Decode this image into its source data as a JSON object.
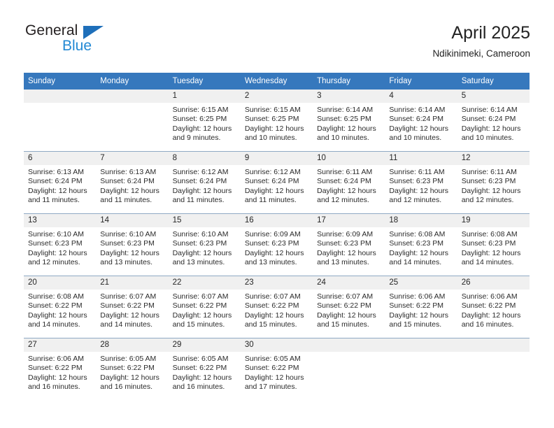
{
  "brand": {
    "name_part1": "General",
    "name_part2": "Blue",
    "triangle_color": "#1e6fba",
    "blue_color": "#2389d4"
  },
  "header": {
    "title": "April 2025",
    "subtitle": "Ndikinimeki, Cameroon"
  },
  "theme": {
    "header_row_bg": "#3678bd",
    "day_number_bg": "#f0f0f0",
    "grid_line": "#8fa9c4",
    "text": "#2b2b2b"
  },
  "weekday_headers": [
    "Sunday",
    "Monday",
    "Tuesday",
    "Wednesday",
    "Thursday",
    "Friday",
    "Saturday"
  ],
  "weeks": [
    [
      {
        "day": "",
        "empty": true,
        "sunrise": "",
        "sunset": "",
        "daylight_line1": "",
        "daylight_line2": ""
      },
      {
        "day": "",
        "empty": true,
        "sunrise": "",
        "sunset": "",
        "daylight_line1": "",
        "daylight_line2": ""
      },
      {
        "day": "1",
        "sunrise": "Sunrise: 6:15 AM",
        "sunset": "Sunset: 6:25 PM",
        "daylight_line1": "Daylight: 12 hours",
        "daylight_line2": "and 9 minutes."
      },
      {
        "day": "2",
        "sunrise": "Sunrise: 6:15 AM",
        "sunset": "Sunset: 6:25 PM",
        "daylight_line1": "Daylight: 12 hours",
        "daylight_line2": "and 10 minutes."
      },
      {
        "day": "3",
        "sunrise": "Sunrise: 6:14 AM",
        "sunset": "Sunset: 6:25 PM",
        "daylight_line1": "Daylight: 12 hours",
        "daylight_line2": "and 10 minutes."
      },
      {
        "day": "4",
        "sunrise": "Sunrise: 6:14 AM",
        "sunset": "Sunset: 6:24 PM",
        "daylight_line1": "Daylight: 12 hours",
        "daylight_line2": "and 10 minutes."
      },
      {
        "day": "5",
        "sunrise": "Sunrise: 6:14 AM",
        "sunset": "Sunset: 6:24 PM",
        "daylight_line1": "Daylight: 12 hours",
        "daylight_line2": "and 10 minutes."
      }
    ],
    [
      {
        "day": "6",
        "sunrise": "Sunrise: 6:13 AM",
        "sunset": "Sunset: 6:24 PM",
        "daylight_line1": "Daylight: 12 hours",
        "daylight_line2": "and 11 minutes."
      },
      {
        "day": "7",
        "sunrise": "Sunrise: 6:13 AM",
        "sunset": "Sunset: 6:24 PM",
        "daylight_line1": "Daylight: 12 hours",
        "daylight_line2": "and 11 minutes."
      },
      {
        "day": "8",
        "sunrise": "Sunrise: 6:12 AM",
        "sunset": "Sunset: 6:24 PM",
        "daylight_line1": "Daylight: 12 hours",
        "daylight_line2": "and 11 minutes."
      },
      {
        "day": "9",
        "sunrise": "Sunrise: 6:12 AM",
        "sunset": "Sunset: 6:24 PM",
        "daylight_line1": "Daylight: 12 hours",
        "daylight_line2": "and 11 minutes."
      },
      {
        "day": "10",
        "sunrise": "Sunrise: 6:11 AM",
        "sunset": "Sunset: 6:24 PM",
        "daylight_line1": "Daylight: 12 hours",
        "daylight_line2": "and 12 minutes."
      },
      {
        "day": "11",
        "sunrise": "Sunrise: 6:11 AM",
        "sunset": "Sunset: 6:23 PM",
        "daylight_line1": "Daylight: 12 hours",
        "daylight_line2": "and 12 minutes."
      },
      {
        "day": "12",
        "sunrise": "Sunrise: 6:11 AM",
        "sunset": "Sunset: 6:23 PM",
        "daylight_line1": "Daylight: 12 hours",
        "daylight_line2": "and 12 minutes."
      }
    ],
    [
      {
        "day": "13",
        "sunrise": "Sunrise: 6:10 AM",
        "sunset": "Sunset: 6:23 PM",
        "daylight_line1": "Daylight: 12 hours",
        "daylight_line2": "and 12 minutes."
      },
      {
        "day": "14",
        "sunrise": "Sunrise: 6:10 AM",
        "sunset": "Sunset: 6:23 PM",
        "daylight_line1": "Daylight: 12 hours",
        "daylight_line2": "and 13 minutes."
      },
      {
        "day": "15",
        "sunrise": "Sunrise: 6:10 AM",
        "sunset": "Sunset: 6:23 PM",
        "daylight_line1": "Daylight: 12 hours",
        "daylight_line2": "and 13 minutes."
      },
      {
        "day": "16",
        "sunrise": "Sunrise: 6:09 AM",
        "sunset": "Sunset: 6:23 PM",
        "daylight_line1": "Daylight: 12 hours",
        "daylight_line2": "and 13 minutes."
      },
      {
        "day": "17",
        "sunrise": "Sunrise: 6:09 AM",
        "sunset": "Sunset: 6:23 PM",
        "daylight_line1": "Daylight: 12 hours",
        "daylight_line2": "and 13 minutes."
      },
      {
        "day": "18",
        "sunrise": "Sunrise: 6:08 AM",
        "sunset": "Sunset: 6:23 PM",
        "daylight_line1": "Daylight: 12 hours",
        "daylight_line2": "and 14 minutes."
      },
      {
        "day": "19",
        "sunrise": "Sunrise: 6:08 AM",
        "sunset": "Sunset: 6:23 PM",
        "daylight_line1": "Daylight: 12 hours",
        "daylight_line2": "and 14 minutes."
      }
    ],
    [
      {
        "day": "20",
        "sunrise": "Sunrise: 6:08 AM",
        "sunset": "Sunset: 6:22 PM",
        "daylight_line1": "Daylight: 12 hours",
        "daylight_line2": "and 14 minutes."
      },
      {
        "day": "21",
        "sunrise": "Sunrise: 6:07 AM",
        "sunset": "Sunset: 6:22 PM",
        "daylight_line1": "Daylight: 12 hours",
        "daylight_line2": "and 14 minutes."
      },
      {
        "day": "22",
        "sunrise": "Sunrise: 6:07 AM",
        "sunset": "Sunset: 6:22 PM",
        "daylight_line1": "Daylight: 12 hours",
        "daylight_line2": "and 15 minutes."
      },
      {
        "day": "23",
        "sunrise": "Sunrise: 6:07 AM",
        "sunset": "Sunset: 6:22 PM",
        "daylight_line1": "Daylight: 12 hours",
        "daylight_line2": "and 15 minutes."
      },
      {
        "day": "24",
        "sunrise": "Sunrise: 6:07 AM",
        "sunset": "Sunset: 6:22 PM",
        "daylight_line1": "Daylight: 12 hours",
        "daylight_line2": "and 15 minutes."
      },
      {
        "day": "25",
        "sunrise": "Sunrise: 6:06 AM",
        "sunset": "Sunset: 6:22 PM",
        "daylight_line1": "Daylight: 12 hours",
        "daylight_line2": "and 15 minutes."
      },
      {
        "day": "26",
        "sunrise": "Sunrise: 6:06 AM",
        "sunset": "Sunset: 6:22 PM",
        "daylight_line1": "Daylight: 12 hours",
        "daylight_line2": "and 16 minutes."
      }
    ],
    [
      {
        "day": "27",
        "sunrise": "Sunrise: 6:06 AM",
        "sunset": "Sunset: 6:22 PM",
        "daylight_line1": "Daylight: 12 hours",
        "daylight_line2": "and 16 minutes."
      },
      {
        "day": "28",
        "sunrise": "Sunrise: 6:05 AM",
        "sunset": "Sunset: 6:22 PM",
        "daylight_line1": "Daylight: 12 hours",
        "daylight_line2": "and 16 minutes."
      },
      {
        "day": "29",
        "sunrise": "Sunrise: 6:05 AM",
        "sunset": "Sunset: 6:22 PM",
        "daylight_line1": "Daylight: 12 hours",
        "daylight_line2": "and 16 minutes."
      },
      {
        "day": "30",
        "sunrise": "Sunrise: 6:05 AM",
        "sunset": "Sunset: 6:22 PM",
        "daylight_line1": "Daylight: 12 hours",
        "daylight_line2": "and 17 minutes."
      },
      {
        "day": "",
        "empty": true,
        "sunrise": "",
        "sunset": "",
        "daylight_line1": "",
        "daylight_line2": ""
      },
      {
        "day": "",
        "empty": true,
        "sunrise": "",
        "sunset": "",
        "daylight_line1": "",
        "daylight_line2": ""
      },
      {
        "day": "",
        "empty": true,
        "sunrise": "",
        "sunset": "",
        "daylight_line1": "",
        "daylight_line2": ""
      }
    ]
  ]
}
